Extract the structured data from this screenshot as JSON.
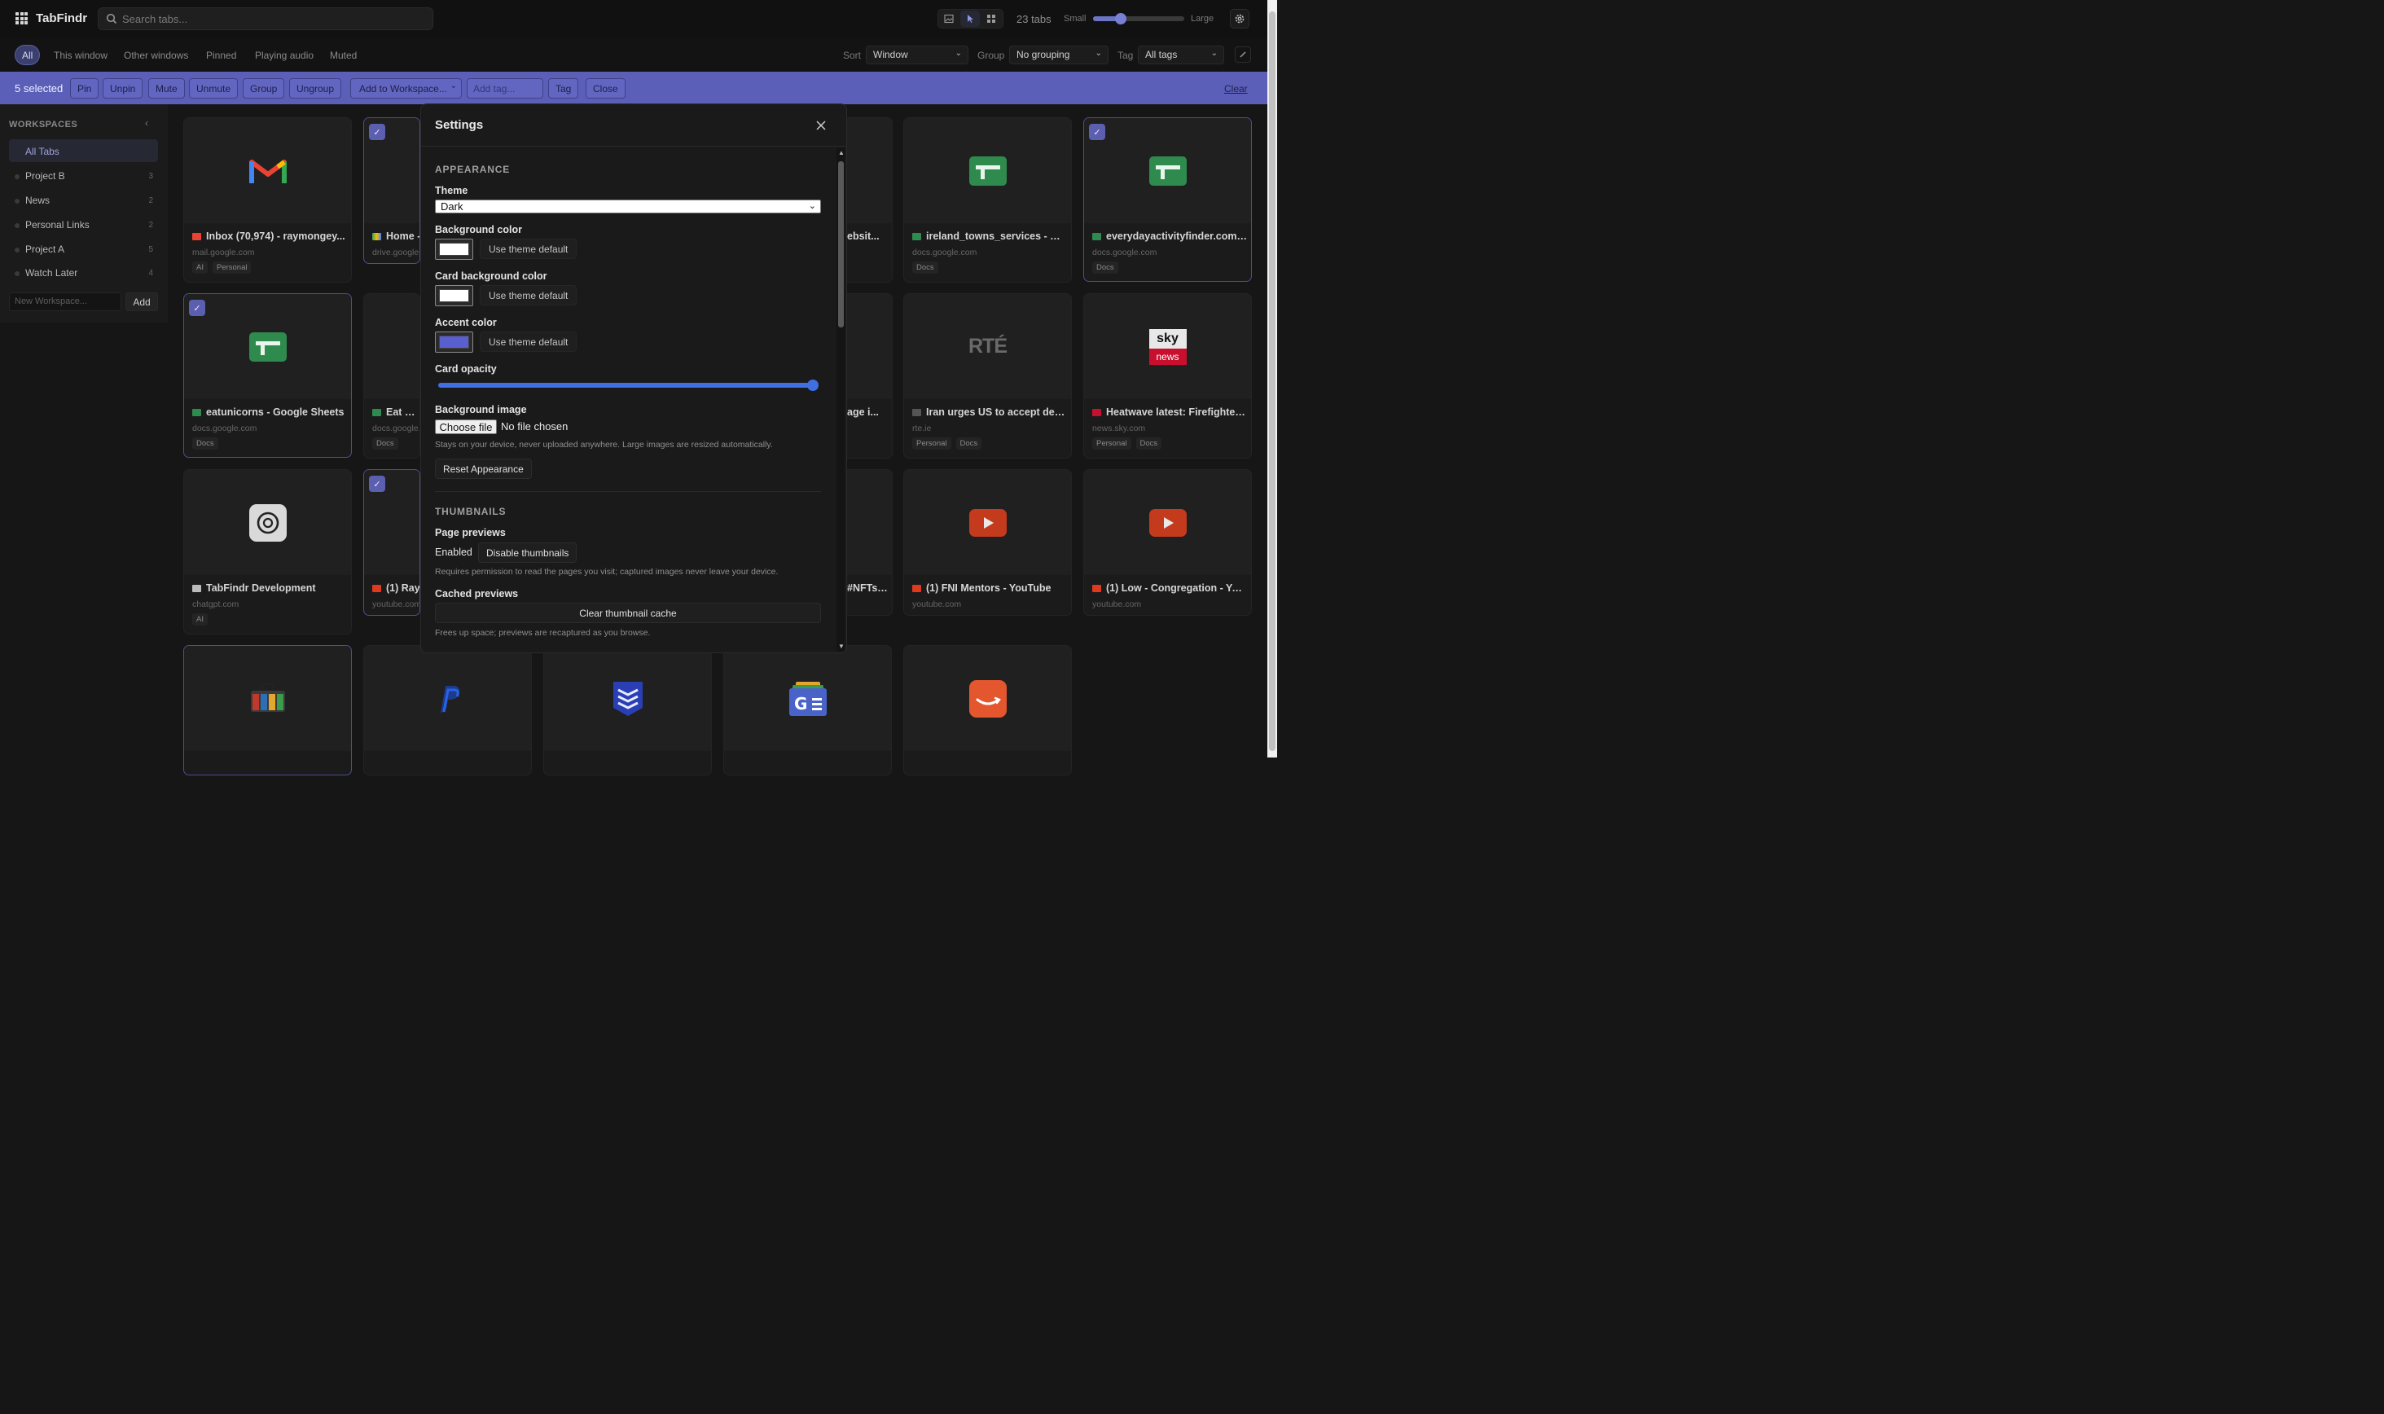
{
  "app": {
    "title": "TabFindr"
  },
  "search": {
    "placeholder": "Search tabs..."
  },
  "header": {
    "tab_count": "23 tabs",
    "size_small": "Small",
    "size_large": "Large",
    "size_value": 0.3
  },
  "filters": [
    "All",
    "This window",
    "Other windows",
    "Pinned",
    "Playing audio",
    "Muted"
  ],
  "controls": {
    "sort_label": "Sort",
    "sort_value": "Window",
    "group_label": "Group",
    "group_value": "No grouping",
    "tag_label": "Tag",
    "tag_value": "All tags"
  },
  "selection": {
    "count": "5 selected",
    "buttons": [
      "Pin",
      "Unpin",
      "Mute",
      "Unmute",
      "Group",
      "Ungroup"
    ],
    "workspace_select": "Add to Workspace...",
    "tag_placeholder": "Add tag...",
    "tag_button": "Tag",
    "close_button": "Close",
    "clear_link": "Clear"
  },
  "sidebar": {
    "title": "WORKSPACES",
    "all_tabs": "All Tabs",
    "items": [
      {
        "label": "Project B",
        "count": "3"
      },
      {
        "label": "News",
        "count": "2"
      },
      {
        "label": "Personal Links",
        "count": "2"
      },
      {
        "label": "Project A",
        "count": "5"
      },
      {
        "label": "Watch Later",
        "count": "4"
      }
    ],
    "new_placeholder": "New Workspace...",
    "add_button": "Add"
  },
  "cards": [
    {
      "title": "Inbox (70,974) - raymongey...",
      "domain": "mail.google.com",
      "tags": [
        "AI",
        "Personal"
      ]
    },
    {
      "title": "Home -",
      "domain": "drive.google.",
      "tags": []
    },
    {
      "title": "ebsit...",
      "domain": "",
      "tags": []
    },
    {
      "title": "ireland_towns_services - Go...",
      "domain": "docs.google.com",
      "tags": [
        "Docs"
      ]
    },
    {
      "title": "everydayactivityfinder.com -...",
      "domain": "docs.google.com",
      "tags": [
        "Docs"
      ]
    },
    {
      "title": "eatunicorns - Google Sheets",
      "domain": "docs.google.com",
      "tags": [
        "Docs"
      ]
    },
    {
      "title": "Eat Unic",
      "domain": "docs.google.",
      "tags": [
        "Docs"
      ]
    },
    {
      "title": "age i...",
      "domain": "",
      "tags": []
    },
    {
      "title": "Iran urges US to accept defe...",
      "domain": "rte.ie",
      "tags": [
        "Personal",
        "Docs"
      ]
    },
    {
      "title": "Heatwave latest: Firefighters...",
      "domain": "news.sky.com",
      "tags": [
        "Personal",
        "Docs"
      ]
    },
    {
      "title": "TabFindr Development",
      "domain": "chatgpt.com",
      "tags": [
        "AI"
      ]
    },
    {
      "title": "(1) Ray",
      "domain": "youtube.com",
      "tags": []
    },
    {
      "title": "#NFTs ...",
      "domain": "",
      "tags": []
    },
    {
      "title": "(1) FNI Mentors - YouTube",
      "domain": "youtube.com",
      "tags": []
    },
    {
      "title": "(1) Low - Congregation - You...",
      "domain": "youtube.com",
      "tags": []
    }
  ],
  "thumb_text": {
    "rte": "RTÉ",
    "sky_top": "sky",
    "sky_bottom": "news"
  },
  "settings": {
    "title": "Settings",
    "appearance_heading": "APPEARANCE",
    "theme_label": "Theme",
    "theme_value": "Dark",
    "bg_color_label": "Background color",
    "card_bg_label": "Card background color",
    "accent_label": "Accent color",
    "use_default": "Use theme default",
    "opacity_label": "Card opacity",
    "opacity_value": 1.0,
    "bg_image_label": "Background image",
    "choose_file": "Choose file",
    "no_file": "No file chosen",
    "bg_image_note": "Stays on your device, never uploaded anywhere. Large images are resized automatically.",
    "reset_button": "Reset Appearance",
    "thumbnails_heading": "THUMBNAILS",
    "previews_label": "Page previews",
    "enabled_text": "Enabled",
    "disable_button": "Disable thumbnails",
    "previews_note": "Requires permission to read the pages you visit; captured images never leave your device.",
    "cached_label": "Cached previews",
    "clear_cache_button": "Clear thumbnail cache",
    "cache_note": "Frees up space; previews are recaptured as you browse."
  },
  "colors": {
    "accent": "#5c5fb8",
    "accent_swatch": "#5a5fd0",
    "slider": "#3f6fe0"
  }
}
